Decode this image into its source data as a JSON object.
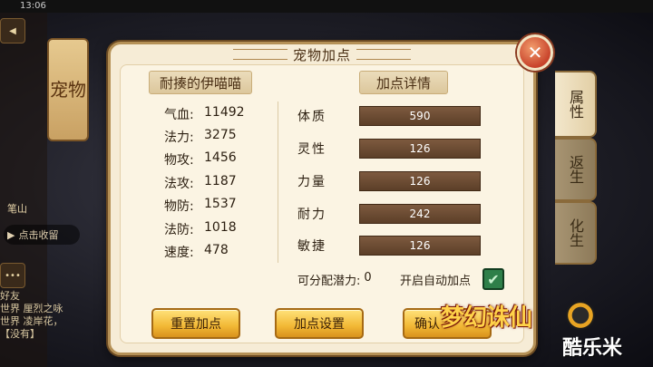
{
  "status_bar": {
    "time": "13:06"
  },
  "background": {
    "left_scroll_label": "宠物",
    "collect_label": "点击收留",
    "chat_lines": [
      "好友",
      "世界 厘烈之咏",
      "世界 凌岸花，",
      "【没有】"
    ],
    "mail_label": "笔山"
  },
  "side_tabs": [
    {
      "label": "属性",
      "active": true
    },
    {
      "label": "返生",
      "active": false
    },
    {
      "label": "化生",
      "active": false
    }
  ],
  "dialog": {
    "title": "宠物加点",
    "close_label": "✕",
    "pet_name": "耐揍的伊喵喵",
    "detail_heading": "加点详情",
    "stats": [
      {
        "label": "气血:",
        "value": "11492"
      },
      {
        "label": "法力:",
        "value": "3275"
      },
      {
        "label": "物攻:",
        "value": "1456"
      },
      {
        "label": "法攻:",
        "value": "1187"
      },
      {
        "label": "物防:",
        "value": "1537"
      },
      {
        "label": "法防:",
        "value": "1018"
      },
      {
        "label": "速度:",
        "value": "478"
      }
    ],
    "attributes": [
      {
        "label": "体质",
        "value": "590"
      },
      {
        "label": "灵性",
        "value": "126"
      },
      {
        "label": "力量",
        "value": "126"
      },
      {
        "label": "耐力",
        "value": "242"
      },
      {
        "label": "敏捷",
        "value": "126"
      }
    ],
    "potential_label": "可分配潜力:",
    "potential_value": "0",
    "auto_add_label": "开启自动加点",
    "auto_add_checked": true,
    "buttons": {
      "reset": "重置加点",
      "settings": "加点设置",
      "confirm": "确认"
    }
  },
  "watermarks": {
    "game_logo": "梦幻诛仙",
    "site_logo": "酷乐米"
  }
}
